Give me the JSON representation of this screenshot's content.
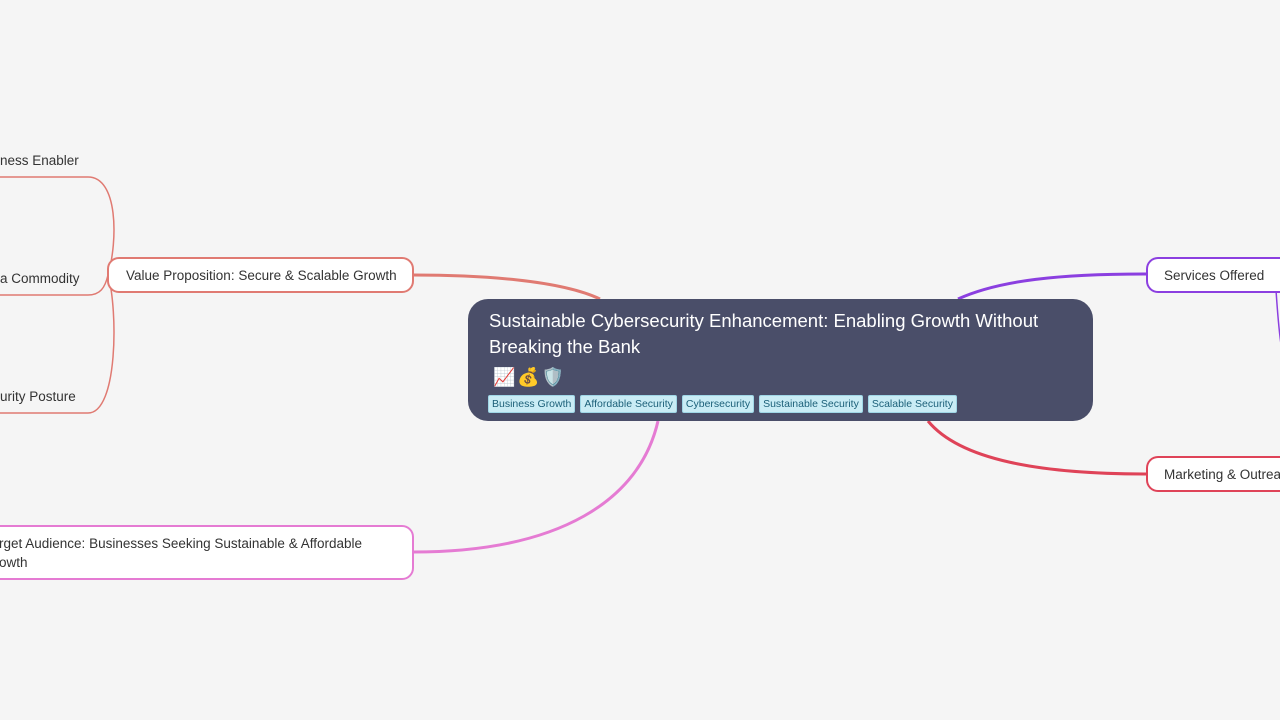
{
  "root": {
    "title": "Sustainable Cybersecurity Enhancement: Enabling Growth Without Breaking the Bank",
    "emoji": "📈💰🛡️",
    "tags": [
      "Business Growth",
      "Affordable Security",
      "Cybersecurity",
      "Sustainable Security",
      "Scalable Security"
    ]
  },
  "branches": {
    "value_proposition": {
      "label": "Value Proposition: Secure & Scalable Growth",
      "color": "#e07a72",
      "children": [
        "ness Enabler",
        "a Commodity",
        "urity Posture"
      ]
    },
    "target_audience": {
      "label": "rget Audience: Businesses Seeking Sustainable & Affordable owth",
      "color": "#e57bd3"
    },
    "services_offered": {
      "label": "Services Offered",
      "color": "#8b3fe0"
    },
    "marketing": {
      "label": "Marketing & Outrea",
      "color": "#df4358"
    }
  }
}
